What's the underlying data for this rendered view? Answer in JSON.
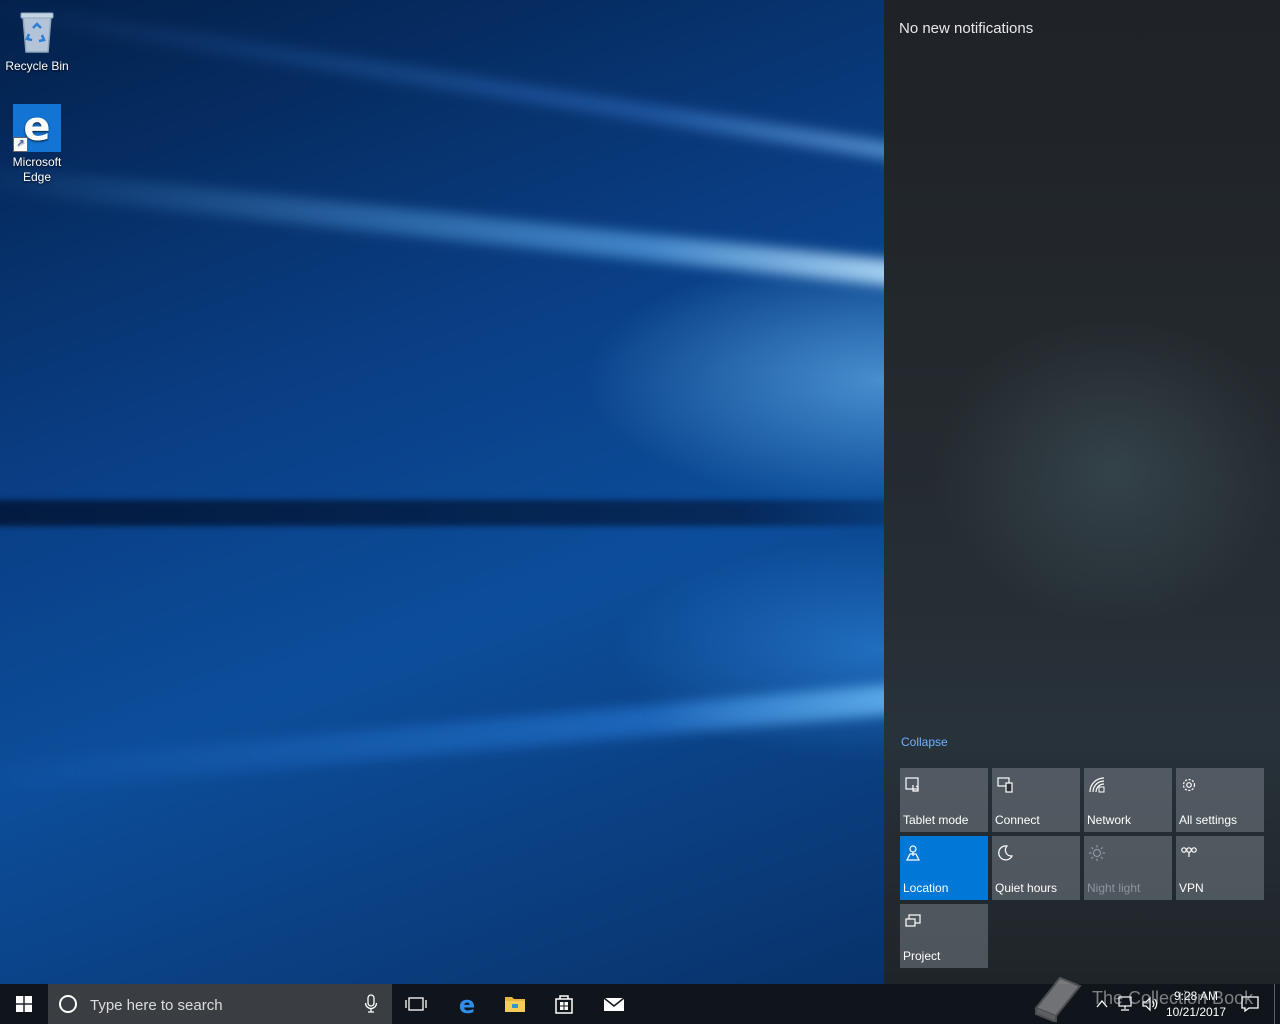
{
  "desktop": {
    "icons": [
      {
        "label": "Recycle Bin",
        "icon": "recycle-bin-icon"
      },
      {
        "label": "Microsoft Edge",
        "icon": "edge-icon"
      }
    ]
  },
  "action_center": {
    "heading": "No new notifications",
    "collapse_label": "Collapse",
    "quick_actions": [
      {
        "label": "Tablet mode",
        "icon": "tablet-mode-icon",
        "state": "off"
      },
      {
        "label": "Connect",
        "icon": "connect-icon",
        "state": "off"
      },
      {
        "label": "Network",
        "icon": "network-icon",
        "state": "off"
      },
      {
        "label": "All settings",
        "icon": "gear-icon",
        "state": "off"
      },
      {
        "label": "Location",
        "icon": "location-icon",
        "state": "on"
      },
      {
        "label": "Quiet hours",
        "icon": "moon-icon",
        "state": "off"
      },
      {
        "label": "Night light",
        "icon": "sun-icon",
        "state": "disabled"
      },
      {
        "label": "VPN",
        "icon": "vpn-icon",
        "state": "off"
      },
      {
        "label": "Project",
        "icon": "project-icon",
        "state": "off"
      }
    ],
    "colors": {
      "active_tile": "#0078d7",
      "link": "#6fb2ff"
    }
  },
  "taskbar": {
    "search_placeholder": "Type here to search",
    "pinned_apps": [
      "task-view-icon",
      "edge-icon",
      "file-explorer-icon",
      "store-icon",
      "mail-icon"
    ],
    "clock": {
      "time": "9:28 AM",
      "date": "10/21/2017"
    }
  },
  "watermark": {
    "text": "The Collection Book"
  }
}
